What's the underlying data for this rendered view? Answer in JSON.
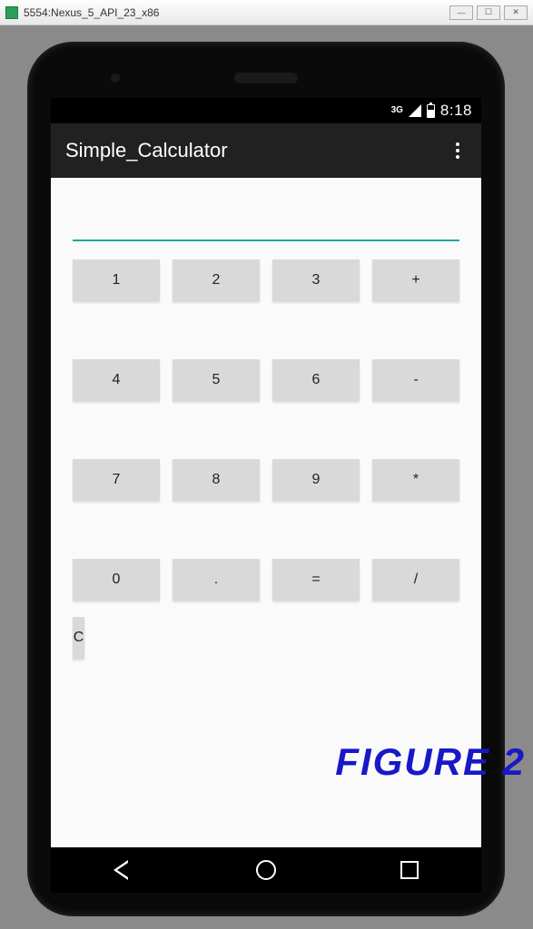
{
  "emulator": {
    "title": "5554:Nexus_5_API_23_x86"
  },
  "statusBar": {
    "network": "3G",
    "time": "8:18"
  },
  "appBar": {
    "title": "Simple_Calculator"
  },
  "display": {
    "value": "",
    "placeholder": ""
  },
  "buttons": {
    "row1": [
      "1",
      "2",
      "3",
      "+"
    ],
    "row2": [
      "4",
      "5",
      "6",
      "-"
    ],
    "row3": [
      "7",
      "8",
      "9",
      "*"
    ],
    "row4": [
      "0",
      ".",
      "=",
      "/"
    ],
    "row5": [
      "C"
    ]
  },
  "figureLabel": "FIGURE 2"
}
